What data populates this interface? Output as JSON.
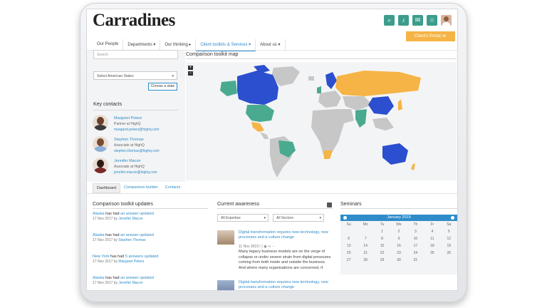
{
  "brand": {
    "logo": "Carradines",
    "accent": "#3c9d8c",
    "link": "#2e8cc9",
    "portal": "#f5b445"
  },
  "header_icons": [
    "search-icon",
    "bell-icon",
    "mail-icon",
    "star-icon"
  ],
  "nav": {
    "items": [
      "Our People",
      "Departments ▾",
      "Our thinking ▸",
      "Client toolkits & Services ▾",
      "About us ▾"
    ],
    "portal_button": "Client's Portal"
  },
  "left": {
    "search_placeholder": "Search",
    "state_select": "Select American States",
    "choose_button": "Choose a state",
    "key_contacts_title": "Key contacts",
    "contacts": [
      {
        "name": "Margaret Peters",
        "role": "Partner at HighQ",
        "email": "margaret.peters@highq.com"
      },
      {
        "name": "Stephen Thomas",
        "role": "Associate at HighQ",
        "email": "stephen.thomas@highq.com"
      },
      {
        "name": "Jennifer Macon",
        "role": "Associate at HighQ",
        "email": "jennifer.macon@highq.com"
      }
    ]
  },
  "map": {
    "title": "Comparison toolkit map",
    "zoom_in": "+",
    "zoom_out": "−",
    "legend_colors": [
      "#2b4fce",
      "#4aaa8f",
      "#f5b445",
      "#c7c7c7"
    ]
  },
  "tabs": [
    "Dashboard",
    "Comparison builder",
    "Contacts"
  ],
  "updates": {
    "title": "Comparison toolkit updates",
    "items": [
      {
        "who": "Alaska",
        "verb": " has had ",
        "what": "an answer updated",
        "date": "17 Nov 2017 by ",
        "by": "Jennifer Macon"
      },
      {
        "who": "Alaska",
        "verb": " has had ",
        "what": "an answer updated",
        "date": "17 Nov 2017 by ",
        "by": "Stephen Thomas"
      },
      {
        "who": "New York",
        "verb": " has had ",
        "what": "5 answers updated",
        "date": "17 Nov 2017 by ",
        "by": "Margaret Peters"
      },
      {
        "who": "Alaska",
        "verb": " has had ",
        "what": "an answer updated",
        "date": "17 Nov 2017 by ",
        "by": "Jennifer Macon"
      }
    ]
  },
  "awareness": {
    "title": "Current awareness",
    "filter_expertise": "All Expertise",
    "filter_sectors": "All Sectors",
    "articles": [
      {
        "title": "Digital transformation requires new technology, new processes and a culture change",
        "meta": "11 Nov 2019",
        "body": "Many legacy business models are on the verge of collapse or under severe strain from digital pressures coming from both inside and outside the business. And where many organisations are concerned, if"
      },
      {
        "title": "Digital transformation requires new technology, new processes and a culture change"
      }
    ]
  },
  "seminars": {
    "title": "Seminars",
    "month": "January 2019",
    "weekdays": [
      "Su",
      "Mo",
      "Tu",
      "We",
      "Th",
      "Fr",
      "Sa"
    ],
    "days": [
      "",
      "",
      "1",
      "2",
      "3",
      "4",
      "5",
      "6",
      "7",
      "8",
      "9",
      "10",
      "11",
      "12",
      "13",
      "14",
      "15",
      "16",
      "17",
      "18",
      "19",
      "20",
      "21",
      "22",
      "23",
      "24",
      "25",
      "26",
      "27",
      "28",
      "29",
      "30",
      "31"
    ]
  }
}
